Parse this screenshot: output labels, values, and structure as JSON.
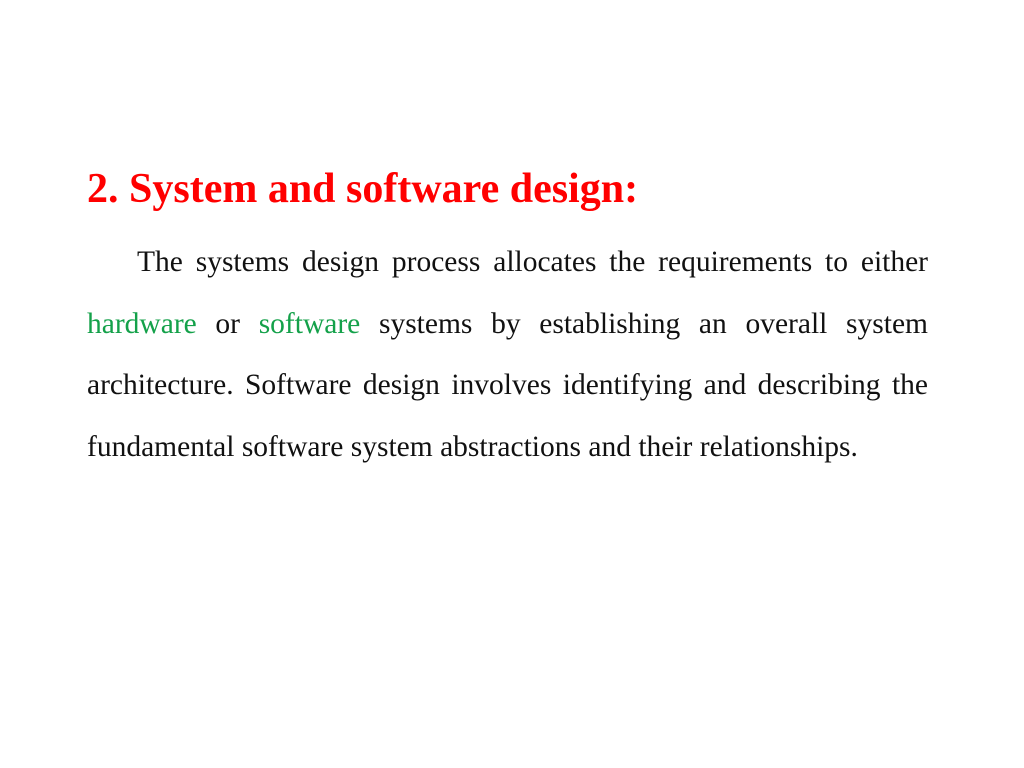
{
  "slide": {
    "heading": "2. System and software design:",
    "paragraph": {
      "part1": "The systems design process allocates the requirements to either ",
      "highlight1": "hardware",
      "part2": " or ",
      "highlight2": "software",
      "part3": " systems by establishing an overall system architecture. Software design involves identifying and describing the fundamental software system abstractions and their relationships."
    },
    "colors": {
      "heading": "#ff0000",
      "highlight": "#14a14a",
      "text": "#111111"
    }
  }
}
